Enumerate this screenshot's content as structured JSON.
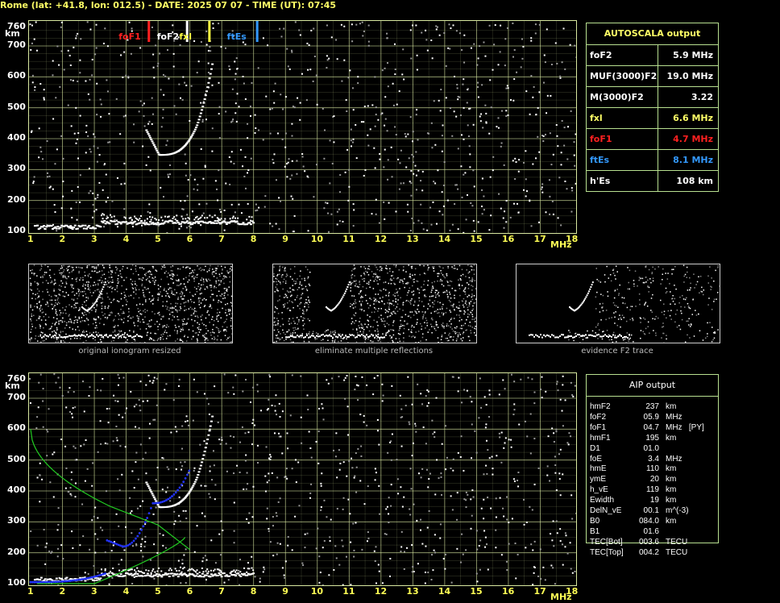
{
  "title": "Rome (lat: +41.8, lon: 012.5) - DATE: 2025 07 07 - TIME (UT): 07:45",
  "axes": {
    "y_unit": "km",
    "x_unit": "MHz",
    "y_ticks": [
      "760",
      "700",
      "600",
      "500",
      "400",
      "300",
      "200",
      "100"
    ],
    "x_ticks": [
      "1",
      "2",
      "3",
      "4",
      "5",
      "6",
      "7",
      "8",
      "9",
      "10",
      "11",
      "12",
      "13",
      "14",
      "15",
      "16",
      "17",
      "18"
    ]
  },
  "markers": [
    {
      "label": "foF1",
      "color": "#ff2020",
      "freq": 4.7
    },
    {
      "label": "foF2",
      "color": "#ffffff",
      "freq": 5.9
    },
    {
      "label": "fxl",
      "color": "#ffff40",
      "freq": 6.6
    },
    {
      "label": "ftEs",
      "color": "#3399ff",
      "freq": 8.1
    }
  ],
  "autoscala": {
    "header": "AUTOSCALA output",
    "rows": [
      {
        "name": "foF2",
        "value": "5.9 MHz",
        "color": "#ffffff"
      },
      {
        "name": "MUF(3000)F2",
        "value": "19.0 MHz",
        "color": "#ffffff"
      },
      {
        "name": "M(3000)F2",
        "value": "3.22",
        "color": "#ffffff"
      },
      {
        "name": "fxl",
        "value": "6.6 MHz",
        "color": "#ffff66"
      },
      {
        "name": "foF1",
        "value": "4.7 MHz",
        "color": "#ff2020"
      },
      {
        "name": "ftEs",
        "value": "8.1 MHz",
        "color": "#3399ff"
      },
      {
        "name": "h'Es",
        "value": "108    km",
        "color": "#ffffff"
      }
    ]
  },
  "thumbnails": [
    {
      "caption": "original ionogram resized"
    },
    {
      "caption": "eliminate multiple reflections"
    },
    {
      "caption": "evidence F2 trace"
    }
  ],
  "aip": {
    "header": "AIP output",
    "rows": [
      {
        "k": "hmF2",
        "v": "237",
        "u": "km"
      },
      {
        "k": "foF2",
        "v": "05.9",
        "u": "MHz"
      },
      {
        "k": "foF1",
        "v": "04.7",
        "u": "MHz   [PY]"
      },
      {
        "k": "hmF1",
        "v": "195",
        "u": "km"
      },
      {
        "k": "D1",
        "v": "01.0",
        "u": ""
      },
      {
        "k": "foE",
        "v": "3.4",
        "u": "MHz"
      },
      {
        "k": "hmE",
        "v": "110",
        "u": "km"
      },
      {
        "k": "ymE",
        "v": "20",
        "u": "km"
      },
      {
        "k": "h_vE",
        "v": "119",
        "u": "km"
      },
      {
        "k": "Ewidth",
        "v": "19",
        "u": "km"
      },
      {
        "k": "DelN_vE",
        "v": "00.1",
        "u": "m^(-3)"
      },
      {
        "k": "B0",
        "v": "084.0",
        "u": "km"
      },
      {
        "k": "B1",
        "v": "01.6",
        "u": ""
      },
      {
        "k": "TEC[Bot]",
        "v": "003.6",
        "u": "TECU"
      },
      {
        "k": "TEC[Top]",
        "v": "004.2",
        "u": "TECU"
      }
    ]
  },
  "colors": {
    "grid": "#d8e8a0",
    "trace": "#ffffff",
    "profile": "#22cc22",
    "fit": "#2233ff"
  }
}
